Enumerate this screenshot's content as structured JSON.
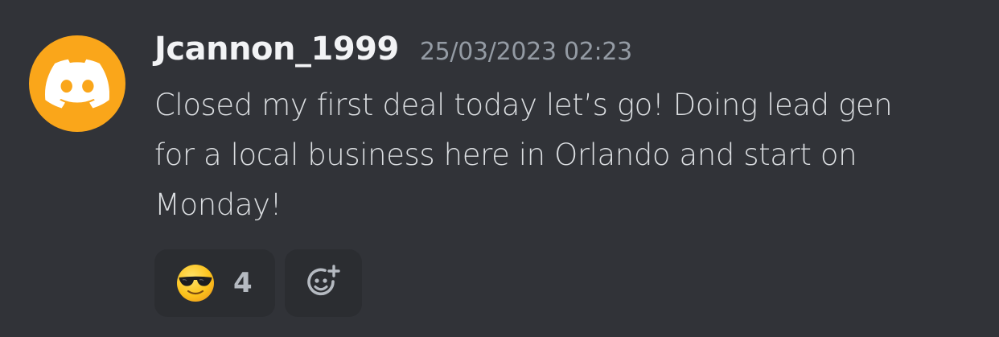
{
  "message": {
    "author": "Jcannon_1999",
    "timestamp": "25/03/2023 02:23",
    "content": "Closed my first deal today let’s go! Doing lead gen\nfor a local business here in Orlando and start on\nMonday!",
    "avatar_icon": "discord-logo-icon",
    "avatar_color": "#faa61a"
  },
  "reactions": [
    {
      "emoji": "smiling-face-with-sunglasses-icon",
      "count": "4"
    }
  ],
  "add_reaction_icon": "add-reaction-icon",
  "colors": {
    "background": "#313338",
    "reaction_background": "#2b2d31",
    "username": "#f2f3f5",
    "timestamp": "#949ba4",
    "text": "#dbdee1"
  }
}
